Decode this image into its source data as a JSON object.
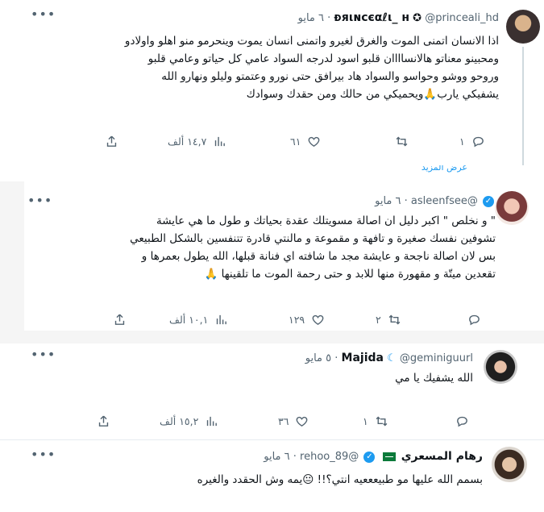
{
  "tweets": [
    {
      "display_name": "ᴆяιɴcєαℓι_ н",
      "handle": "@princeali_hd",
      "date": "٦ مايو",
      "lines": [
        "اذا الانسان اتمنى الموت والغرق لغيرو واتمنى انسان يموت وينحرمو منو اهلو واولادو",
        "ومحبينو معناتو هالانساااان قلبو اسود لدرجه السواد عامي كل حياتو وعامي قلبو",
        "وروحو ووشو وحواسو والسواد هاد بيرافق حتى نورو وعتمتو وليلو ونهارو الله",
        "يشفيكي يارب🙏ويحميكي من حالك ومن حقدك وسوادك"
      ],
      "reply_count": "١",
      "retweet_count": "",
      "like_count": "٦١",
      "views": "١٤,٧ ألف"
    },
    {
      "display_name": "",
      "handle": "@asleenfsee",
      "date": "٦ مايو",
      "lines": [
        "\" و نخلص \" اكبر دليل ان اصالة مسويتلك عقدة بحياتك و طول ما هي عايشة",
        "تشوفين نفسك صغيرة و تافهة و مقموعة و مالنتي قادرة تتنفسين بالشكل الطبيعي",
        "بس لان اصالة ناجحة و عايشة مجد ما شافته اي فنانة قبلها، الله يطول بعمرها و",
        "تقعدين ميتّة و مقهورة منها للابد و حتى رحمة الموت ما تلقينها 🙏"
      ],
      "reply_count": "",
      "retweet_count": "٢",
      "like_count": "١٢٩",
      "views": "١٠,١ ألف"
    },
    {
      "display_name": "Majida",
      "handle": "@geminiguurl",
      "date": "٥ مايو",
      "lines": [
        "الله يشفيك يا مي"
      ],
      "reply_count": "",
      "retweet_count": "١",
      "like_count": "٣٦",
      "views": "١٥,٢ ألف"
    },
    {
      "display_name": "رهام المسعري",
      "handle": "@rehoo_89",
      "date": "٦ مايو",
      "lines": [
        "بسمم الله عليها مو طبيعععيه انتي؟!! 😐يمه وش الحقدد والغيره"
      ]
    }
  ],
  "partial_text": "عرض المزيد",
  "colors": {
    "text": "#0f1419",
    "secondary": "#536471",
    "verified": "#1d9bf0",
    "divider": "#e6ecf0"
  }
}
